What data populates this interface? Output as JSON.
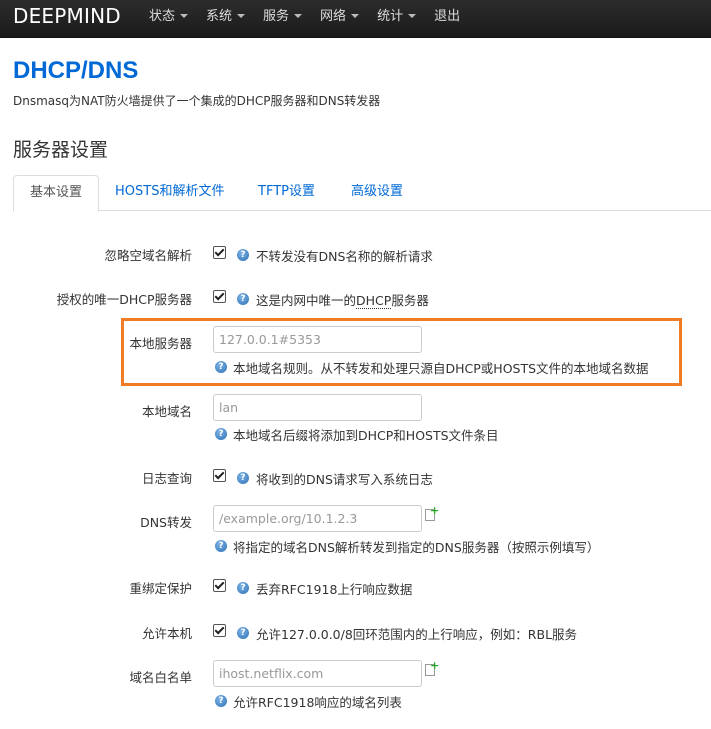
{
  "brand": "DEEPMIND",
  "nav": [
    {
      "label": "状态",
      "has_caret": true
    },
    {
      "label": "系统",
      "has_caret": true
    },
    {
      "label": "服务",
      "has_caret": true
    },
    {
      "label": "网络",
      "has_caret": true
    },
    {
      "label": "统计",
      "has_caret": true
    },
    {
      "label": "退出",
      "has_caret": false
    }
  ],
  "page": {
    "title": "DHCP/DNS",
    "description": "Dnsmasq为NAT防火墙提供了一个集成的DHCP服务器和DNS转发器",
    "section_title": "服务器设置"
  },
  "tabs": [
    {
      "label": "基本设置",
      "active": true
    },
    {
      "label": "HOSTS和解析文件",
      "active": false
    },
    {
      "label": "TFTP设置",
      "active": false
    },
    {
      "label": "高级设置",
      "active": false
    }
  ],
  "fields": {
    "domain_needed": {
      "label": "忽略空域名解析",
      "checked": true,
      "help": "不转发没有DNS名称的解析请求"
    },
    "authoritative": {
      "label": "授权的唯一DHCP服务器",
      "checked": true,
      "help_prefix": "这是内网中唯一的",
      "help_link": "DHCP",
      "help_suffix": "服务器"
    },
    "local_server": {
      "label": "本地服务器",
      "value": "127.0.0.1#5353",
      "help": "本地域名规则。从不转发和处理只源自DHCP或HOSTS文件的本地域名数据"
    },
    "local_domain": {
      "label": "本地域名",
      "value": "lan",
      "help": "本地域名后缀将添加到DHCP和HOSTS文件条目"
    },
    "log_queries": {
      "label": "日志查询",
      "checked": true,
      "help": "将收到的DNS请求写入系统日志"
    },
    "dns_forward": {
      "label": "DNS转发",
      "placeholder": "/example.org/10.1.2.3",
      "help": "将指定的域名DNS解析转发到指定的DNS服务器（按照示例填写）"
    },
    "rebind_protection": {
      "label": "重绑定保护",
      "checked": true,
      "help": "丢弃RFC1918上行响应数据"
    },
    "rebind_localhost": {
      "label": "允许本机",
      "checked": true,
      "help": "允许127.0.0.0/8回环范围内的上行响应，例如：RBL服务"
    },
    "rebind_domain": {
      "label": "域名白名单",
      "placeholder": "ihost.netflix.com",
      "help": "允许RFC1918响应的域名列表"
    }
  },
  "colors": {
    "accent": "#0069d6",
    "highlight": "#f07d24",
    "navbar": "#222222"
  },
  "icons": {
    "help": "help-icon",
    "add": "add-entry-icon"
  }
}
